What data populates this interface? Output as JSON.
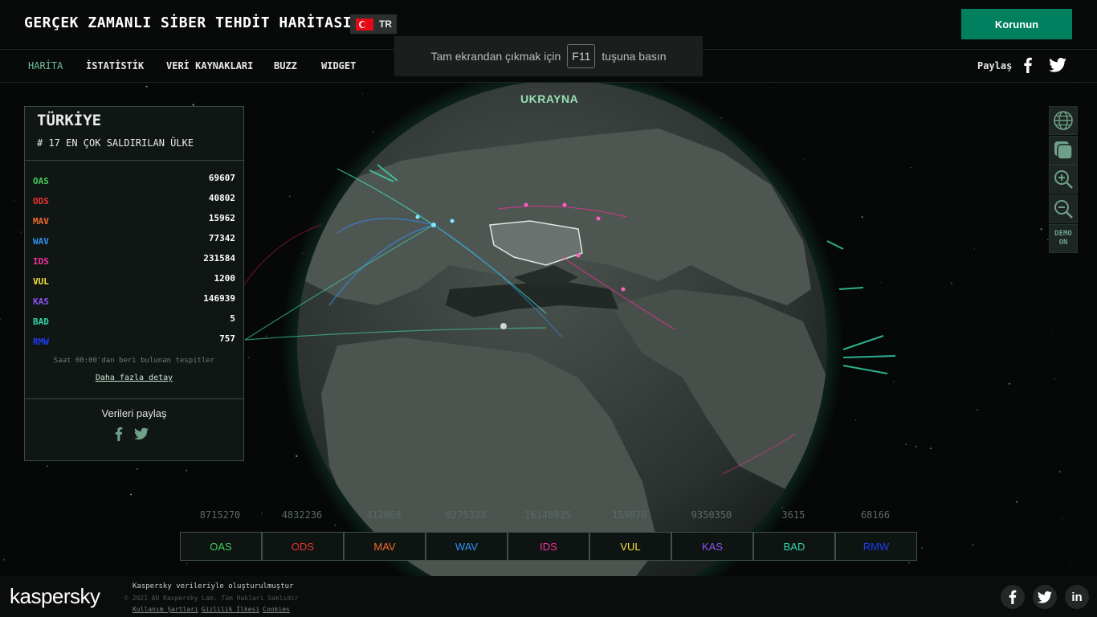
{
  "header": {
    "title": "GERÇEK ZAMANLI SİBER TEHDİT HARİTASI",
    "language_code": "TR",
    "cta_label": "Korunun"
  },
  "nav": {
    "items": [
      {
        "label": "HARİTA",
        "active": true
      },
      {
        "label": "İSTATİSTİK",
        "active": false
      },
      {
        "label": "VERİ KAYNAKLARI",
        "active": false
      },
      {
        "label": "BUZZ",
        "active": false
      },
      {
        "label": "WIDGET",
        "active": false
      }
    ],
    "share_label": "Paylaş"
  },
  "fullscreen_toast": {
    "before": "Tam ekrandan çıkmak için",
    "key": "F11",
    "after": "tuşuna basın"
  },
  "map": {
    "highlighted_country": "UKRAYNA"
  },
  "country_panel": {
    "country": "TÜRKİYE",
    "rank_text": "# 17 EN ÇOK SALDIRILAN ÜLKE",
    "stats": [
      {
        "code": "OAS",
        "value": "69607",
        "color": "#3fcf5a"
      },
      {
        "code": "ODS",
        "value": "40802",
        "color": "#e8322f"
      },
      {
        "code": "MAV",
        "value": "15962",
        "color": "#f2692a"
      },
      {
        "code": "WAV",
        "value": "77342",
        "color": "#2f8ff0"
      },
      {
        "code": "IDS",
        "value": "231584",
        "color": "#f0319d"
      },
      {
        "code": "VUL",
        "value": "1200",
        "color": "#f3e13a"
      },
      {
        "code": "KAS",
        "value": "146939",
        "color": "#8a55f0"
      },
      {
        "code": "BAD",
        "value": "5",
        "color": "#2fd6a6"
      },
      {
        "code": "RMW",
        "value": "757",
        "color": "#1f3df0"
      }
    ],
    "note": "Saat 00:00'dan beri bulunan tespitler",
    "detail_link": "Daha fazla detay",
    "share_title": "Verileri paylaş"
  },
  "tools": {
    "demo_label_1": "DEMO",
    "demo_label_2": "ON"
  },
  "bottom_bar": [
    {
      "code": "OAS",
      "count": "8715270",
      "color": "#3fcf5a"
    },
    {
      "code": "ODS",
      "count": "4832236",
      "color": "#e8322f"
    },
    {
      "code": "MAV",
      "count": "412068",
      "color": "#f2692a"
    },
    {
      "code": "WAV",
      "count": "8275323",
      "color": "#2f8ff0"
    },
    {
      "code": "IDS",
      "count": "16148935",
      "color": "#f0319d"
    },
    {
      "code": "VUL",
      "count": "159876",
      "color": "#f3e13a"
    },
    {
      "code": "KAS",
      "count": "9350350",
      "color": "#8a55f0"
    },
    {
      "code": "BAD",
      "count": "3615",
      "color": "#2fd6a6"
    },
    {
      "code": "RMW",
      "count": "68166",
      "color": "#1f3df0"
    }
  ],
  "footer": {
    "logo": "kaspersky",
    "line1": "Kaspersky verileriyle oluşturulmuştur",
    "line2": "© 2021 AO Kaspersky Lab. Tüm Hakları Saklıdır",
    "links": [
      "Kullanım Şartları",
      "Gizlilik İlkesi",
      "Cookies"
    ]
  }
}
